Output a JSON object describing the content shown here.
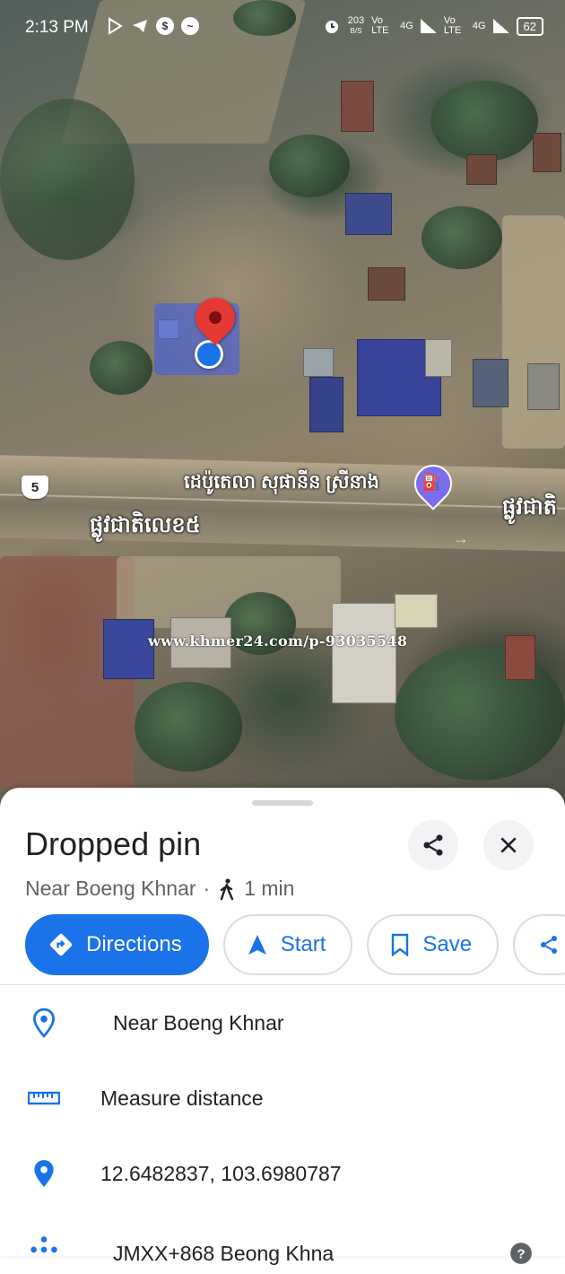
{
  "status_bar": {
    "time": "2:13 PM",
    "speed": "203",
    "speed_unit": "B/S",
    "net1": "Vo LTE",
    "net2": "4G",
    "net3": "Vo LTE",
    "net4": "4G",
    "battery": "62"
  },
  "map": {
    "route_shield": "5",
    "gas_station_name": "ដេប៉ូតេលា សុផានីន ស្រីនាង",
    "road_name": "ផ្លូវជាតិលេខ៥",
    "road_name_right": "ផ្លូវជាតិ",
    "watermark": "www.khmer24.com/p-93035548"
  },
  "place": {
    "title": "Dropped pin",
    "near": "Near Boeng Khnar",
    "separator": "·",
    "walk_time": "1 min"
  },
  "actions": {
    "directions": "Directions",
    "start": "Start",
    "save": "Save"
  },
  "details": {
    "address": "Near Boeng Khnar",
    "measure": "Measure distance",
    "coordinates": "12.6482837, 103.6980787",
    "plus_code": "JMXX+868 Beong Khna"
  },
  "colors": {
    "accent": "#1a73e8",
    "pin": "#e53935"
  }
}
